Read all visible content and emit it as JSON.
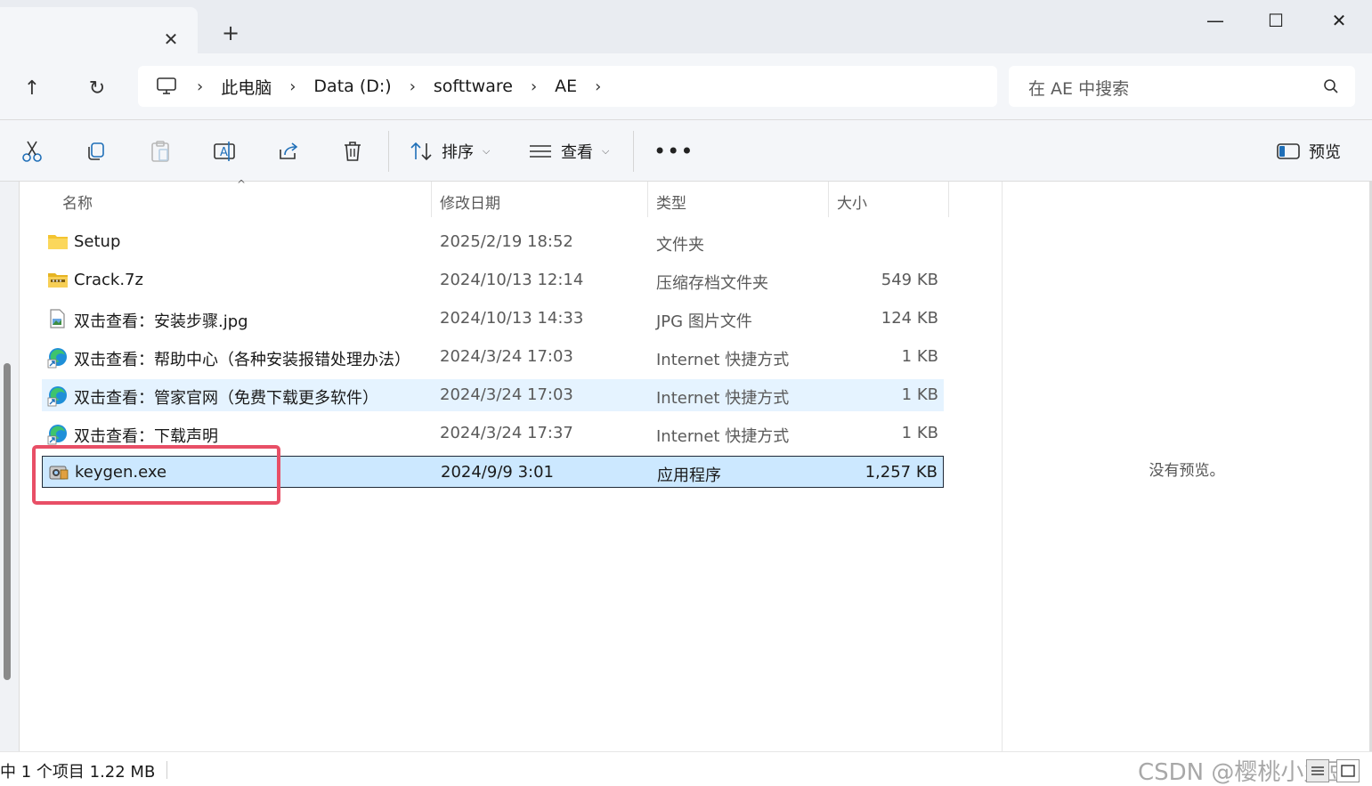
{
  "tabstrip": {
    "close_glyph": "✕",
    "new_tab_glyph": "+",
    "minimize_glyph": "—",
    "maximize_glyph": "☐",
    "close_window_glyph": "✕"
  },
  "nav": {
    "up_glyph": "↑",
    "refresh_glyph": "↻",
    "breadcrumb": [
      "此电脑",
      "Data (D:)",
      "softtware",
      "AE"
    ],
    "separator": "›",
    "search_placeholder": "在 AE 中搜索"
  },
  "toolbar": {
    "sort_label": "排序",
    "view_label": "查看",
    "more_label": "•••",
    "preview_label": "预览",
    "chevron": "⌵"
  },
  "columns": {
    "name": "名称",
    "date": "修改日期",
    "type": "类型",
    "size": "大小",
    "sort_caret": "^"
  },
  "files": [
    {
      "name": "Setup",
      "date": "2025/2/19 18:52",
      "type": "文件夹",
      "size": "",
      "icon": "folder-icon"
    },
    {
      "name": "Crack.7z",
      "date": "2024/10/13 12:14",
      "type": "压缩存档文件夹",
      "size": "549 KB",
      "icon": "zip-folder-icon"
    },
    {
      "name": "双击查看：安装步骤.jpg",
      "date": "2024/10/13 14:33",
      "type": "JPG 图片文件",
      "size": "124 KB",
      "icon": "image-file-icon"
    },
    {
      "name": "双击查看：帮助中心（各种安装报错处理办法）",
      "date": "2024/3/24 17:03",
      "type": "Internet 快捷方式",
      "size": "1 KB",
      "icon": "edge-shortcut-icon"
    },
    {
      "name": "双击查看：管家官网（免费下载更多软件）",
      "date": "2024/3/24 17:03",
      "type": "Internet 快捷方式",
      "size": "1 KB",
      "icon": "edge-shortcut-icon"
    },
    {
      "name": "双击查看：下载声明",
      "date": "2024/3/24 17:37",
      "type": "Internet 快捷方式",
      "size": "1 KB",
      "icon": "edge-shortcut-icon"
    },
    {
      "name": "keygen.exe",
      "date": "2024/9/9 3:01",
      "type": "应用程序",
      "size": "1,257 KB",
      "icon": "exe-icon"
    }
  ],
  "preview": {
    "no_preview_text": "没有预览。"
  },
  "status": {
    "text": "中 1 个项目  1.22 MB",
    "watermark": "CSDN @樱桃小丸豆"
  },
  "colors": {
    "selected_row": "#cce8ff",
    "hover_row": "#e5f3ff",
    "highlight_box": "#e84f66",
    "chrome_bg": "#f4f6f9"
  }
}
